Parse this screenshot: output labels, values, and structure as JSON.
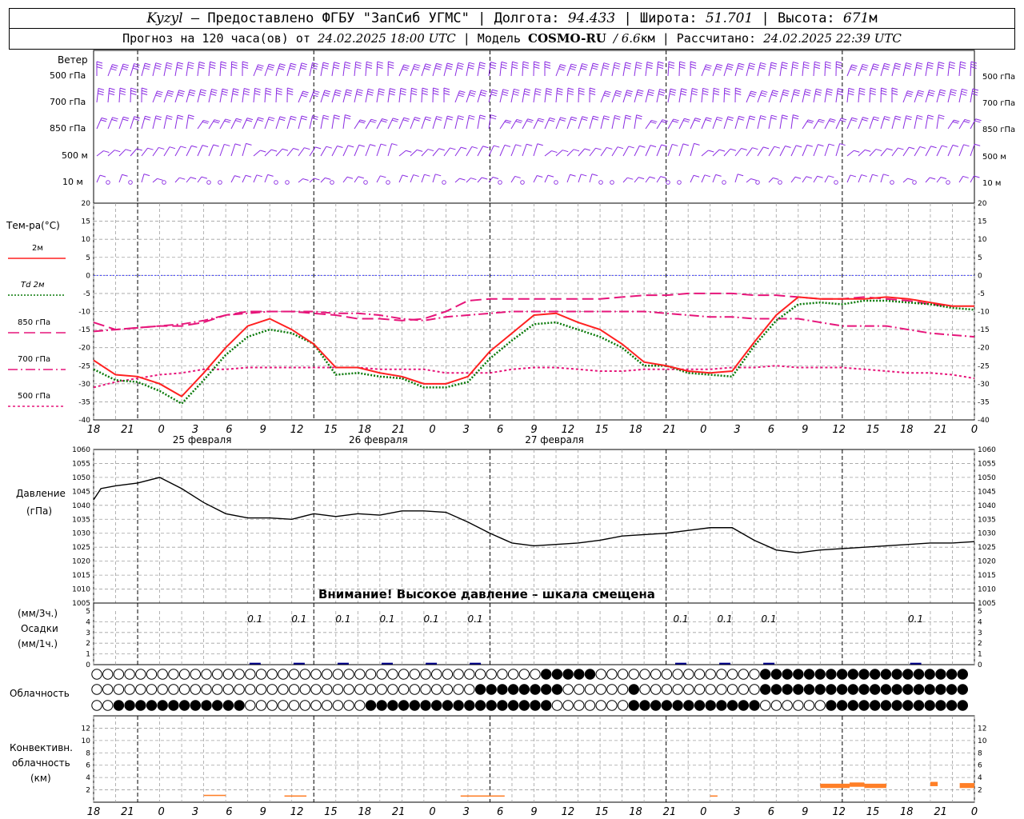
{
  "header": {
    "station": "Kyzyl",
    "provided": "– Предоставлено ФГБУ \"ЗапСиб УГМС\" |",
    "lon_label": "Долгота:",
    "lon": "94.433",
    "lat_label": "| Широта:",
    "lat": "51.701",
    "alt_label": "| Высота:",
    "alt": "671",
    "alt_unit": "м",
    "forecast_label": "Прогноз на 120 часа(ов) от",
    "forecast_start": "24.02.2025 18:00 UTC",
    "model_label": "| Модель",
    "model": "COSMO-RU",
    "model_res": "/ 6.6",
    "model_res_unit": "км",
    "calc_label": "| Рассчитано:",
    "calc_time": "24.02.2025 22:39 UTC"
  },
  "wind_panel": {
    "title": "Ветер",
    "levels": [
      "500 гПа",
      "700 гПа",
      "850 гПа",
      "500 м",
      "10 м"
    ]
  },
  "temp_panel": {
    "title": "Тем-ра(°C)",
    "legend": [
      {
        "label": "2м",
        "color": "#ff2020",
        "dash": ""
      },
      {
        "label": "Td  2м",
        "color": "#0a7a0a",
        "dash": "2,2"
      },
      {
        "label": "850 гПа",
        "color": "#e6157a",
        "dash": "14,6"
      },
      {
        "label": "700 гПа",
        "color": "#e6157a",
        "dash": "12,4,2,4"
      },
      {
        "label": "500 гПа",
        "color": "#e6157a",
        "dash": "3,3"
      }
    ]
  },
  "pressure_panel": {
    "title": "Давление",
    "unit": "(гПа)",
    "warning": "Внимание! Высокое давление – шкала смещена"
  },
  "precip_panel": {
    "unit_left": "(мм/3ч.)",
    "title": "Осадки",
    "unit_right": "(мм/1ч.)",
    "labels": [
      "0.1",
      "0.1",
      "0.1",
      "0.1",
      "0.1",
      "0.1",
      "0.1",
      "0.1",
      "0.1",
      "0.1"
    ]
  },
  "cloud_panel": {
    "title": "Облачность"
  },
  "conv_panel": {
    "title_1": "Конвективн.",
    "title_2": "облачность",
    "title_3": "(км)"
  },
  "time_axis": {
    "hour_labels": [
      "18",
      "21",
      "0",
      "3",
      "6",
      "9",
      "12",
      "15",
      "18",
      "21",
      "0",
      "3",
      "6",
      "9",
      "12",
      "15",
      "18",
      "21",
      "0",
      "3",
      "6",
      "9",
      "12",
      "15",
      "18",
      "21",
      "0"
    ],
    "day_labels": [
      "25 февраля",
      "26 февраля",
      "27 февраля"
    ]
  },
  "colors": {
    "wind": "#8a2be2",
    "grid": "#a0a0a0",
    "conv": "#ff7f27",
    "precip": "#00008b",
    "zero_line": "#4040ff"
  },
  "chart_data": [
    {
      "type": "line",
      "title": "Тем-ра(°C)",
      "x_hours_from_start": [
        0,
        3,
        6,
        9,
        12,
        15,
        18,
        21,
        24,
        27,
        30,
        33,
        36,
        39,
        42,
        45,
        48,
        51,
        54,
        57,
        60,
        63,
        66,
        69,
        72,
        75,
        78,
        81,
        84,
        87,
        90,
        93,
        96,
        99,
        102,
        105,
        108,
        111,
        114,
        117,
        120
      ],
      "ylim": [
        -40,
        20
      ],
      "yticks": [
        -40,
        -35,
        -30,
        -25,
        -20,
        -15,
        -10,
        -5,
        0,
        5,
        10,
        15,
        20
      ],
      "series": [
        {
          "name": "2м",
          "values": [
            -23.5,
            -27.5,
            -28,
            -30,
            -33.5,
            -27,
            -20,
            -14,
            -12,
            -15,
            -19,
            -25.5,
            -25.5,
            -27,
            -28,
            -30,
            -30,
            -28,
            -21,
            -16,
            -11,
            -10.5,
            -13,
            -15,
            -19,
            -24,
            -25,
            -26.5,
            -27,
            -26.5,
            -18.5,
            -11,
            -6,
            -6.5,
            -6.5,
            -6.5,
            -6,
            -6.5,
            -7.5,
            -8.5,
            -8.5
          ]
        },
        {
          "name": "Td  2м",
          "values": [
            -26,
            -29,
            -29.5,
            -32,
            -35.5,
            -29,
            -22,
            -17,
            -15,
            -16,
            -19,
            -27.5,
            -27,
            -28,
            -28.5,
            -31,
            -31,
            -29.5,
            -23,
            -18,
            -13.5,
            -13,
            -15,
            -17,
            -20,
            -25,
            -25,
            -27,
            -27.5,
            -28,
            -19.5,
            -12.5,
            -8,
            -7.5,
            -8,
            -7,
            -7,
            -7.5,
            -8,
            -9,
            -9.5
          ]
        },
        {
          "name": "850 гПа",
          "values": [
            -13,
            -15,
            -14.5,
            -14,
            -14,
            -13,
            -11,
            -10,
            -10,
            -10,
            -10.5,
            -11,
            -12,
            -12,
            -12.5,
            -12,
            -10,
            -7,
            -6.5,
            -6.5,
            -6.5,
            -6.5,
            -6.5,
            -6.5,
            -6,
            -5.5,
            -5.5,
            -5,
            -5,
            -5,
            -5.5,
            -5.5,
            -6,
            -6.5,
            -6.5,
            -6,
            -6.5,
            -7,
            -8,
            -8.5
          ]
        },
        {
          "name": "700 гПа",
          "values": [
            -15.5,
            -15,
            -14.5,
            -14,
            -13.5,
            -12.5,
            -11,
            -10.5,
            -10,
            -10,
            -10,
            -10.5,
            -10.5,
            -11,
            -12,
            -12.5,
            -11.5,
            -11,
            -10.5,
            -10,
            -10,
            -10,
            -10,
            -10,
            -10,
            -10,
            -10.5,
            -11,
            -11.5,
            -11.5,
            -12,
            -12,
            -12,
            -13,
            -14,
            -14,
            -14,
            -15,
            -16,
            -16.5,
            -17
          ]
        },
        {
          "name": "500 гПа",
          "values": [
            -31,
            -29.5,
            -28.5,
            -27.5,
            -27,
            -26,
            -26,
            -25.5,
            -25.5,
            -25.5,
            -25.5,
            -25.5,
            -25.5,
            -26,
            -26,
            -26,
            -27,
            -27,
            -27,
            -26,
            -25.5,
            -25.5,
            -26,
            -26.5,
            -26.5,
            -26,
            -26,
            -26,
            -26,
            -25.5,
            -25.5,
            -25,
            -25.5,
            -25.5,
            -25.5,
            -26,
            -26.5,
            -27,
            -27,
            -27.5,
            -28.5
          ]
        }
      ]
    },
    {
      "type": "line",
      "title": "Давление",
      "ylabel": "(гПа)",
      "ylim": [
        1005,
        1060
      ],
      "yticks": [
        1005,
        1010,
        1015,
        1020,
        1025,
        1030,
        1035,
        1040,
        1045,
        1050,
        1055,
        1060
      ],
      "x_hours_from_start": [
        0,
        1,
        3,
        6,
        9,
        12,
        15,
        18,
        21,
        24,
        27,
        30,
        33,
        36,
        39,
        40,
        42,
        45,
        48,
        51,
        54,
        57,
        60,
        63,
        66,
        69,
        72,
        75,
        78,
        81,
        84,
        87,
        90,
        93,
        96,
        99,
        102,
        105,
        108,
        111,
        114,
        117,
        120
      ],
      "values": [
        1042,
        1046,
        1047,
        1048,
        1050,
        1046,
        1041,
        1037,
        1035.5,
        1035.5,
        1035,
        1037,
        1036,
        1037,
        1036.5,
        1037,
        1038,
        1038,
        1037.5,
        1034,
        1030,
        1026.5,
        1025.5,
        1026,
        1026.5,
        1027.5,
        1029,
        1029.5,
        1030,
        1031,
        1032,
        1032,
        1027.5,
        1024,
        1023,
        1024,
        1024.5,
        1025,
        1025.5,
        1026,
        1026.5,
        1026.5,
        1027
      ]
    },
    {
      "type": "bar",
      "title": "Осадки",
      "ylabel": "(мм/3ч.)",
      "ylim": [
        0,
        5
      ],
      "yticks": [
        0,
        1,
        2,
        3,
        4,
        5
      ],
      "x_hours_from_start": [
        22,
        28,
        34,
        40,
        46,
        52,
        80,
        86,
        92,
        112
      ],
      "values": [
        0.1,
        0.1,
        0.1,
        0.1,
        0.1,
        0.1,
        0.1,
        0.1,
        0.1,
        0.1
      ]
    },
    {
      "type": "bar",
      "title": "Конвективн. облачность",
      "ylabel": "(км)",
      "ylim": [
        0,
        14
      ],
      "yticks": [
        0,
        2,
        4,
        6,
        8,
        10,
        12
      ],
      "segments": [
        {
          "start_h": 15,
          "end_h": 18,
          "bottom": 1.0,
          "top": 1.2
        },
        {
          "start_h": 26,
          "end_h": 29,
          "bottom": 0.9,
          "top": 1.1
        },
        {
          "start_h": 50,
          "end_h": 56,
          "bottom": 0.9,
          "top": 1.1
        },
        {
          "start_h": 84,
          "end_h": 85,
          "bottom": 0.9,
          "top": 1.1
        },
        {
          "start_h": 99,
          "end_h": 103,
          "bottom": 2.3,
          "top": 3.0
        },
        {
          "start_h": 103,
          "end_h": 105,
          "bottom": 2.5,
          "top": 3.2
        },
        {
          "start_h": 105,
          "end_h": 108,
          "bottom": 2.3,
          "top": 3.0
        },
        {
          "start_h": 114,
          "end_h": 115,
          "bottom": 2.6,
          "top": 3.3
        },
        {
          "start_h": 118,
          "end_h": 120,
          "bottom": 2.3,
          "top": 3.1
        }
      ]
    }
  ]
}
